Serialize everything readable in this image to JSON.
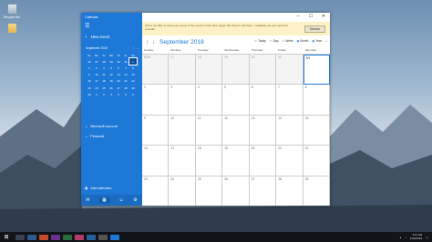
{
  "desktop": {
    "icons": [
      {
        "label": "Recycle Bin",
        "icon": "recycle-bin-icon"
      },
      {
        "label": "",
        "icon": "folder-icon"
      }
    ]
  },
  "sidebar": {
    "title": "Calendar",
    "new_event": "New event",
    "mini_calendar": {
      "month": "September 2018",
      "day_names": [
        "Su",
        "Mo",
        "Tu",
        "We",
        "Th",
        "Fr",
        "Sa"
      ],
      "weeks": [
        [
          "26",
          "27",
          "28",
          "29",
          "30",
          "31",
          "1"
        ],
        [
          "2",
          "3",
          "4",
          "5",
          "6",
          "7",
          "8"
        ],
        [
          "9",
          "10",
          "11",
          "12",
          "13",
          "14",
          "15"
        ],
        [
          "16",
          "17",
          "18",
          "19",
          "20",
          "21",
          "22"
        ],
        [
          "23",
          "24",
          "25",
          "26",
          "27",
          "28",
          "29"
        ],
        [
          "30",
          "1",
          "2",
          "3",
          "4",
          "5",
          "6"
        ]
      ]
    },
    "accounts": [
      {
        "label": "Microsoft account"
      },
      {
        "label": "Personal"
      }
    ],
    "add_calendars": "Add calendars"
  },
  "notice": {
    "message": "We're not able to show you some of the events in this time range. But they're still there - available via your account provider.",
    "dismiss": "Dismiss"
  },
  "toolbar": {
    "month_title": "September 2018",
    "views": [
      "Today",
      "Day",
      "Week",
      "Month",
      "Year"
    ]
  },
  "month_view": {
    "day_headers": [
      "Sunday",
      "Monday",
      "Tuesday",
      "Wednesday",
      "Thursday",
      "Friday",
      "Saturday"
    ],
    "weeks": [
      [
        "8/26",
        "27",
        "28",
        "29",
        "30",
        "31",
        "9/1"
      ],
      [
        "2",
        "3",
        "4",
        "5",
        "6",
        "7",
        "8"
      ],
      [
        "9",
        "10",
        "11",
        "12",
        "13",
        "14",
        "15"
      ],
      [
        "16",
        "17",
        "18",
        "19",
        "20",
        "21",
        "22"
      ],
      [
        "23",
        "24",
        "25",
        "26",
        "27",
        "28",
        "29"
      ]
    ]
  },
  "taskbar": {
    "time": "3:11 AM",
    "date": "1/26/2019"
  },
  "colors": {
    "accent": "#1e78d7",
    "notice_bg": "#fdf2c7",
    "taskbar": "#101418"
  }
}
